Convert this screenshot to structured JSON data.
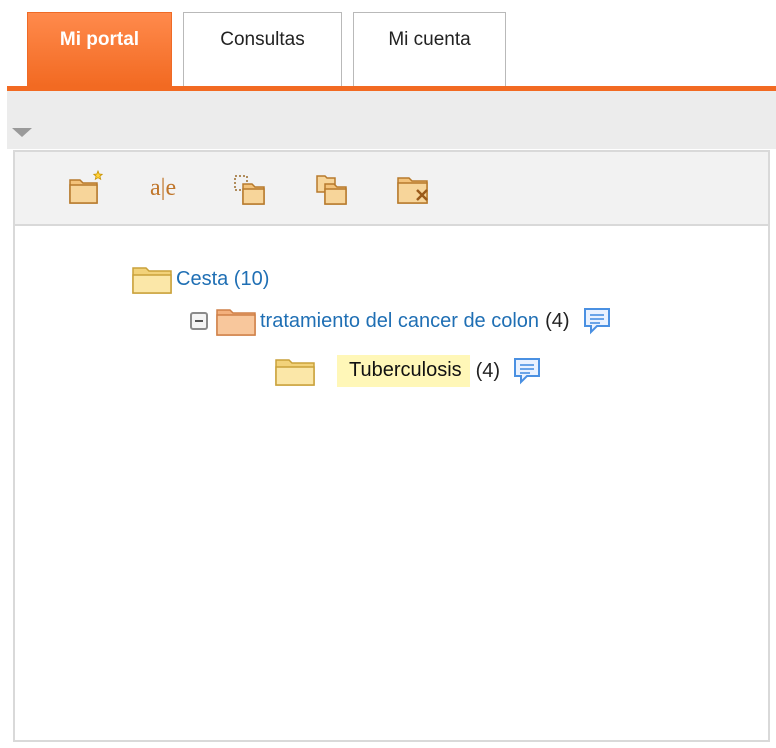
{
  "tabs": [
    {
      "label": "Mi portal",
      "active": true
    },
    {
      "label": "Consultas",
      "active": false
    },
    {
      "label": "Mi cuenta",
      "active": false
    }
  ],
  "toolbar": {
    "buttons": [
      {
        "icon": "new-folder-icon"
      },
      {
        "icon": "rename-icon",
        "text": "a|e"
      },
      {
        "icon": "cut-folder-icon"
      },
      {
        "icon": "copy-folder-icon"
      },
      {
        "icon": "delete-folder-icon"
      }
    ]
  },
  "tree": {
    "root": {
      "label": "Cesta (10)",
      "icon": "folder-open-icon"
    },
    "child": {
      "label": "tratamiento del cancer de colon",
      "count": "(4)",
      "icon": "folder-closed-icon",
      "toggle": "collapse"
    },
    "grandchild": {
      "label": "Tuberculosis",
      "count": "(4)",
      "icon": "folder-open-icon",
      "selected": true
    }
  },
  "colors": {
    "accent": "#f26a22",
    "link": "#1f6fb4",
    "selection": "#fff7b8"
  }
}
